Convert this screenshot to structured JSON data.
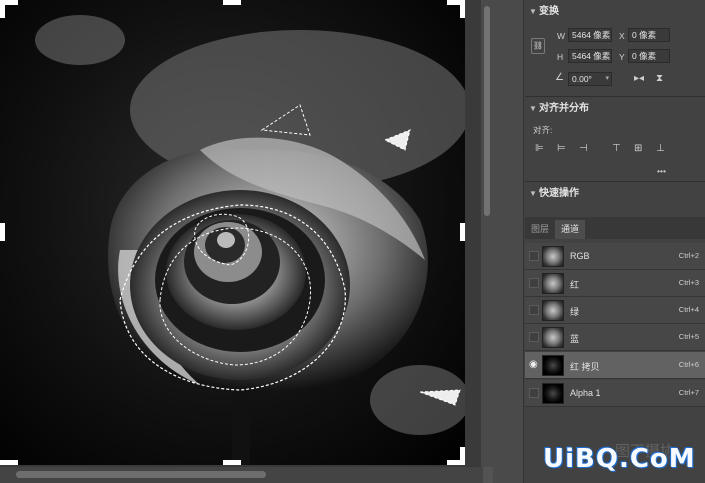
{
  "properties": {
    "transform": {
      "title": "变换",
      "w_label": "W",
      "w_value": "5464 像素",
      "h_label": "H",
      "h_value": "5464 像素",
      "x_label": "X",
      "x_value": "0 像素",
      "y_label": "Y",
      "y_value": "0 像素",
      "angle_value": "0.00°"
    },
    "align": {
      "title": "对齐并分布",
      "sub_label": "对齐:",
      "more": "•••"
    },
    "quick_actions": {
      "title": "快速操作"
    }
  },
  "panel_tabs": [
    "图层",
    "通道"
  ],
  "channels": [
    {
      "name": "RGB",
      "shortcut": "Ctrl+2",
      "visible": false,
      "dark": false
    },
    {
      "name": "红",
      "shortcut": "Ctrl+3",
      "visible": false,
      "dark": false
    },
    {
      "name": "绿",
      "shortcut": "Ctrl+4",
      "visible": false,
      "dark": false
    },
    {
      "name": "蓝",
      "shortcut": "Ctrl+5",
      "visible": false,
      "dark": false
    },
    {
      "name": "红 拷贝",
      "shortcut": "Ctrl+6",
      "visible": true,
      "dark": true
    },
    {
      "name": "Alpha 1",
      "shortcut": "Ctrl+7",
      "visible": false,
      "dark": true
    }
  ],
  "watermark": {
    "text": "UiBQ.CoM",
    "cn_text": "图下摄协"
  },
  "icons": {
    "eye": "eye-icon",
    "link": "link-icon",
    "chevron": "chevron-down-icon"
  }
}
